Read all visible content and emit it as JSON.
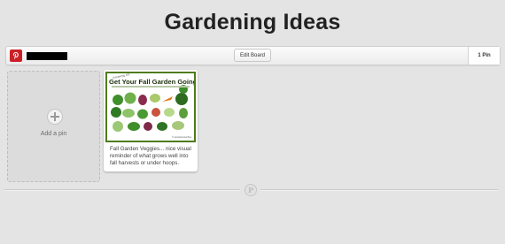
{
  "board": {
    "title": "Gardening Ideas",
    "edit_label": "Edit Board",
    "pin_count": "1 Pin"
  },
  "owner": {
    "avatar_icon": "pinterest-logo-icon",
    "name_redacted": true,
    "brand_color": "#cb2027"
  },
  "add_pin": {
    "icon": "plus-icon",
    "label": "Add a pin"
  },
  "pins": [
    {
      "image_title": "Get Your Fall Garden Going",
      "image_tagline": "Gardening 101",
      "image_credit": "© HomeGrownTips",
      "description": "Fall Garden Veggies... nice visual reminder of what grows well into fall harvests or under hoops."
    }
  ],
  "footer": {
    "logo_icon": "pinterest-p-icon",
    "logo_glyph": "P"
  },
  "colors": {
    "background": "#e4e4e4",
    "pin_border": "#4d7c1c"
  }
}
